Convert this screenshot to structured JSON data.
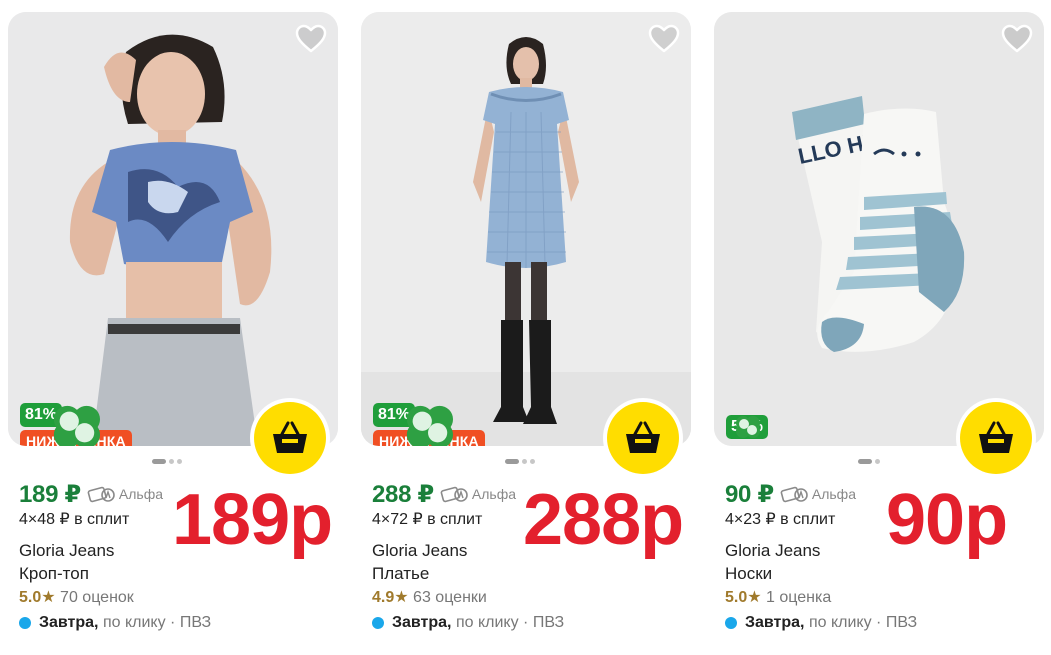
{
  "products": [
    {
      "discount": "81%",
      "below_market": "НИЖЕ РЫНКА",
      "price": "189 ₽",
      "bank": "Альфа",
      "split": "4×48 ₽ в сплит",
      "brand": "Gloria Jeans",
      "name": "Кроп-топ",
      "rating": "5.0",
      "reviews": "70 оценок",
      "delivery_day": "Завтра,",
      "delivery_rest": "по клику · ПВЗ",
      "overlay_price": "189р",
      "image": "woman-crop-top-photo"
    },
    {
      "discount": "81%",
      "below_market": "НИЖЕ РЫНКА",
      "price": "288 ₽",
      "bank": "Альфа",
      "split": "4×72 ₽ в сплит",
      "brand": "Gloria Jeans",
      "name": "Платье",
      "rating": "4.9",
      "reviews": "63 оценки",
      "delivery_day": "Завтра,",
      "delivery_rest": "по клику · ПВЗ",
      "overlay_price": "288р",
      "image": "woman-dress-photo"
    },
    {
      "discount": "55%",
      "below_market": "",
      "price": "90 ₽",
      "bank": "Альфа",
      "split": "4×23 ₽ в сплит",
      "brand": "Gloria Jeans",
      "name": "Носки",
      "rating": "5.0",
      "reviews": "1 оценка",
      "delivery_day": "Завтра,",
      "delivery_rest": "по клику · ПВЗ",
      "overlay_price": "90р",
      "image": "socks-photo"
    }
  ],
  "icons": {
    "favorite": "heart-outline-icon",
    "cart": "basket-icon",
    "cashback": "clover-icon",
    "bank": "alfa-split-icon",
    "star": "★"
  },
  "colors": {
    "price_green": "#1a7f3a",
    "discount_green": "#1f9e3a",
    "below_market_orange": "#f04f23",
    "cart_yellow": "#ffdd00",
    "overlay_red": "#e3202d",
    "rating_gold": "#a07a2c",
    "delivery_blue": "#1aa7ea"
  }
}
